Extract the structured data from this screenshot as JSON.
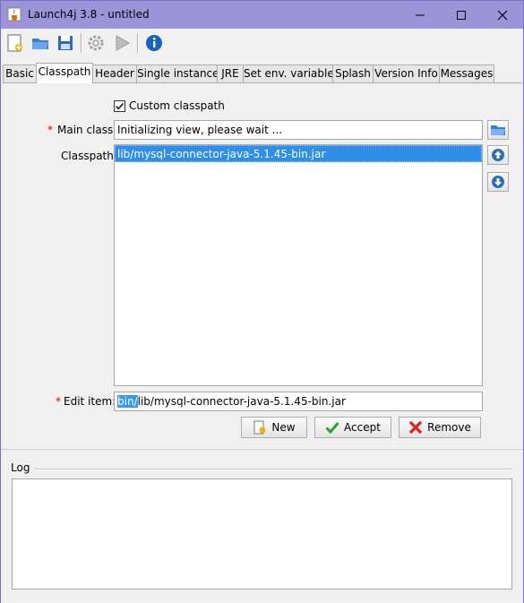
{
  "window": {
    "title": "Launch4j 3.8 - untitled",
    "icon": "java-cup-icon",
    "controls": [
      "minimize-icon",
      "maximize-icon",
      "close-icon"
    ]
  },
  "toolbar": {
    "buttons": [
      "new-file-icon",
      "open-folder-icon",
      "save-icon",
      "build-gear-icon",
      "run-play-icon",
      "info-icon"
    ]
  },
  "tabs": [
    {
      "label": "Basic",
      "active": false
    },
    {
      "label": "Classpath",
      "active": true
    },
    {
      "label": "Header",
      "active": false
    },
    {
      "label": "Single instance",
      "active": false
    },
    {
      "label": "JRE",
      "active": false
    },
    {
      "label": "Set env. variables",
      "active": false
    },
    {
      "label": "Splash",
      "active": false
    },
    {
      "label": "Version Info",
      "active": false
    },
    {
      "label": "Messages",
      "active": false
    }
  ],
  "classpath": {
    "custom_checkbox_label": "Custom classpath",
    "custom_checked": true,
    "main_class_label": "Main class:",
    "main_class_value": "Initializing view, please wait ...",
    "classpath_label": "Classpath:",
    "classpath_items": [
      "lib/mysql-connector-java-5.1.45-bin.jar"
    ],
    "edit_item_label": "Edit item:",
    "edit_item_selected": "bin/",
    "edit_item_rest": "lib/mysql-connector-java-5.1.45-bin.jar",
    "required_marker": "*",
    "new_label": "New",
    "accept_label": "Accept",
    "remove_label": "Remove"
  },
  "log": {
    "label": "Log",
    "content": ""
  }
}
